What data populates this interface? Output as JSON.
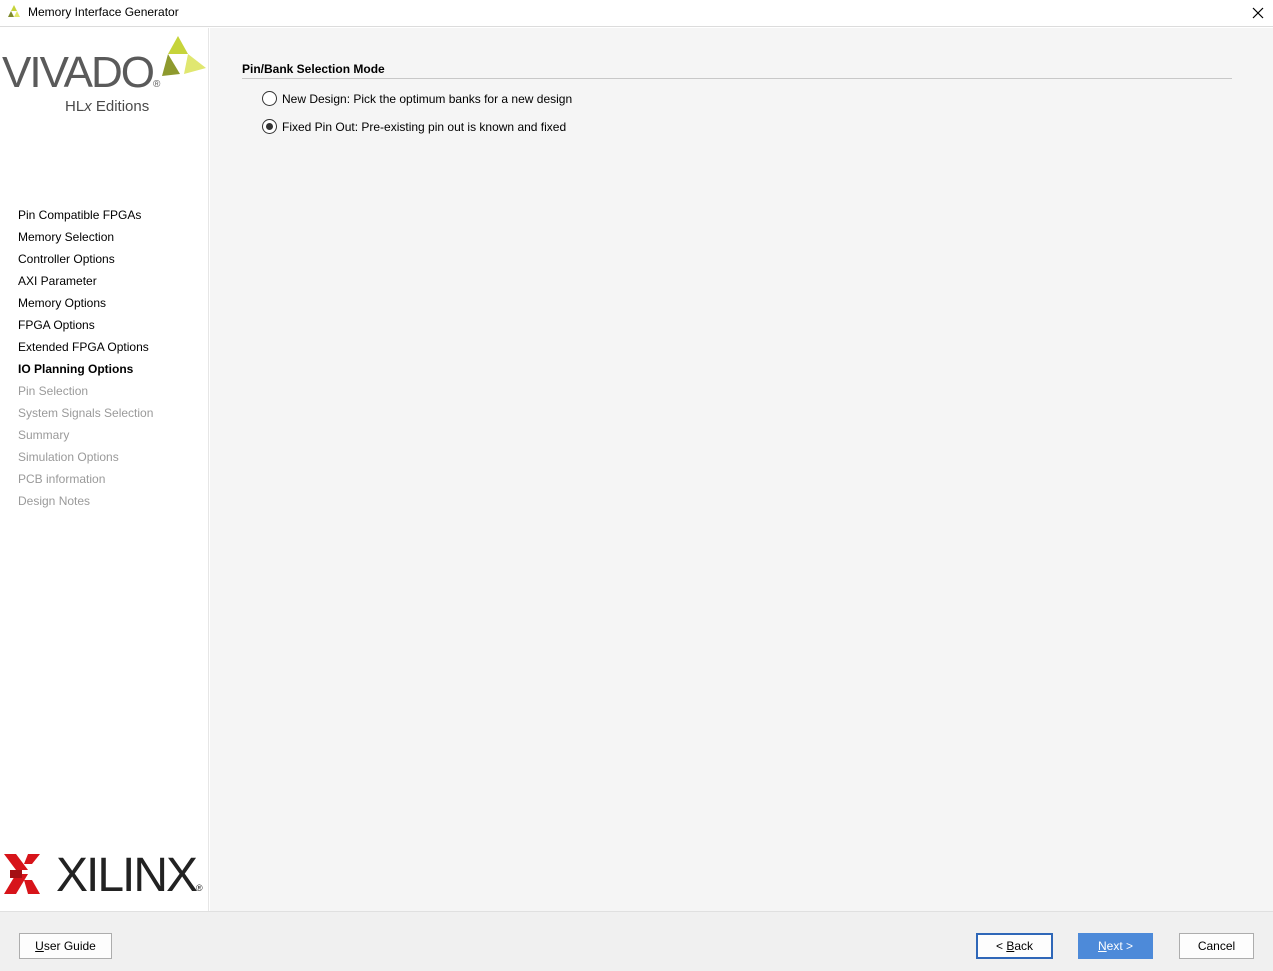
{
  "window": {
    "title": "Memory Interface Generator",
    "close_symbol": "✕"
  },
  "branding": {
    "vivado": "VIVADO",
    "vivado_sub_a": "HL",
    "vivado_sub_x": "x",
    "vivado_sub_b": " Editions",
    "vivado_reg": "®",
    "xilinx": "XILINX",
    "xilinx_reg": "®"
  },
  "sidebar": {
    "items": [
      {
        "label": "Pin Compatible FPGAs",
        "state": "done"
      },
      {
        "label": "Memory Selection",
        "state": "done"
      },
      {
        "label": "Controller Options",
        "state": "done"
      },
      {
        "label": "AXI Parameter",
        "state": "done"
      },
      {
        "label": "Memory Options",
        "state": "done"
      },
      {
        "label": "FPGA Options",
        "state": "done"
      },
      {
        "label": "Extended FPGA Options",
        "state": "done"
      },
      {
        "label": "IO Planning Options",
        "state": "active"
      },
      {
        "label": "Pin Selection",
        "state": "disabled"
      },
      {
        "label": "System Signals Selection",
        "state": "disabled"
      },
      {
        "label": "Summary",
        "state": "disabled"
      },
      {
        "label": "Simulation Options",
        "state": "disabled"
      },
      {
        "label": "PCB information",
        "state": "disabled"
      },
      {
        "label": "Design Notes",
        "state": "disabled"
      }
    ]
  },
  "main": {
    "section_title": "Pin/Bank Selection Mode",
    "options": [
      {
        "label": "New Design: Pick the optimum banks for a new design",
        "checked": false
      },
      {
        "label": "Fixed Pin Out: Pre-existing pin out is known and fixed",
        "checked": true
      }
    ]
  },
  "footer": {
    "user_guide_u": "U",
    "user_guide_rest": "ser Guide",
    "back_pre": "< ",
    "back_u": "B",
    "back_rest": "ack",
    "next_u": "N",
    "next_rest": "ext >",
    "cancel": "Cancel"
  },
  "colors": {
    "accent": "#4d8ad9",
    "xilinx_red": "#d7141a",
    "vivado_green": "#c6d43a"
  }
}
